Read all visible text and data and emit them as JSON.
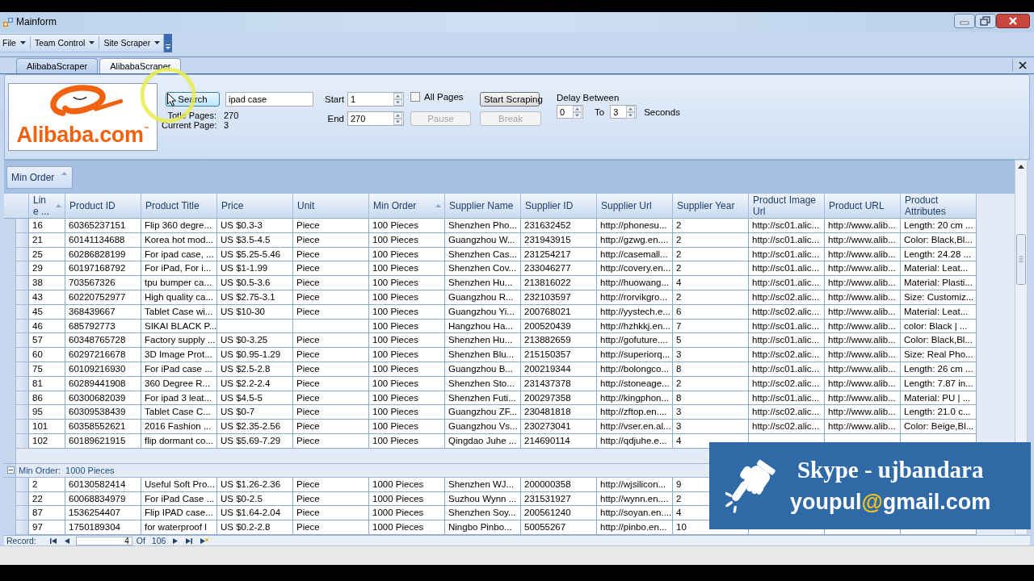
{
  "window": {
    "title": "Mainform"
  },
  "menu": [
    {
      "label": "File"
    },
    {
      "label": "Team Control"
    },
    {
      "label": "Site Scraper"
    }
  ],
  "tabs": [
    {
      "label": "AlibabaScraper",
      "selected": false
    },
    {
      "label": "AlibabaScraper",
      "selected": true
    }
  ],
  "search_panel": {
    "logo_text": "Alibaba.com$^{™}$",
    "search_button": {
      "label": "Search",
      "hovered": true,
      "disabled": false
    },
    "query": {
      "value": "ipad case"
    },
    "stats": [
      {
        "label": "Totle Pages:",
        "value": "270"
      },
      {
        "label": "Current Page:",
        "value": "3"
      }
    ],
    "start": {
      "label": "Start",
      "value": "1"
    },
    "end": {
      "label": "End",
      "value": "270"
    },
    "all_pages": {
      "label": "All Pages",
      "checked": false
    },
    "buttons": [
      {
        "label": "Start Scraping",
        "hovered": false,
        "disabled": false
      },
      {
        "label": "Pause",
        "hovered": false,
        "disabled": true
      },
      {
        "label": "Break",
        "hovered": false,
        "disabled": true
      }
    ],
    "delay": {
      "label": "Delay Between",
      "from": "0",
      "to_label": "To",
      "to": "3",
      "unit": "Seconds"
    }
  },
  "group_panel": {
    "chips": [
      {
        "label": "Min Order",
        "sorted": true
      }
    ]
  },
  "table": {
    "columns": [
      {
        "label": "Lin e ...",
        "sorted": true
      },
      {
        "label": "Product ID",
        "sorted": false
      },
      {
        "label": "Product Title",
        "sorted": false
      },
      {
        "label": "Price",
        "sorted": false
      },
      {
        "label": "Unit",
        "sorted": false
      },
      {
        "label": "Min Order",
        "sorted": true
      },
      {
        "label": "Supplier Name",
        "sorted": false
      },
      {
        "label": "Supplier ID",
        "sorted": false
      },
      {
        "label": "Supplier Url",
        "sorted": false
      },
      {
        "label": "Supplier Year",
        "sorted": false
      },
      {
        "label": "Product Image Url",
        "sorted": false
      },
      {
        "label": "Product URL",
        "sorted": false
      },
      {
        "label": "Product Attributes",
        "sorted": false
      }
    ],
    "groups": [
      {
        "rows": [
          [
            "16",
            "60365237151",
            "Flip 360 degre...",
            "US $0.3-3",
            "Piece",
            "100 Pieces",
            "Shenzhen Pho...",
            "231632452",
            "http://phonesu...",
            "2",
            "http://sc01.alic...",
            "http://www.alib...",
            "Length: 20 cm ..."
          ],
          [
            "21",
            "60141134688",
            "Korea hot mod...",
            "US $3.5-4.5",
            "Piece",
            "100 Pieces",
            "Guangzhou W...",
            "231943915",
            "http://gzwg.en....",
            "2",
            "http://sc01.alic...",
            "http://www.alib...",
            "Color: Black,Bl..."
          ],
          [
            "25",
            "60286828199",
            "For ipad case, ...",
            "US $5.25-5.46",
            "Piece",
            "100 Pieces",
            "Shenzhen Cas...",
            "231254217",
            "http://casemall...",
            "2",
            "http://sc01.alic...",
            "http://www.alib...",
            "Length: 24.28 ..."
          ],
          [
            "29",
            "60197168792",
            "For iPad, For i...",
            "US $1-1.99",
            "Piece",
            "100 Pieces",
            "Shenzhen Cov...",
            "233046277",
            "http://covery.en...",
            "2",
            "http://sc01.alic...",
            "http://www.alib...",
            "Material: Leat..."
          ],
          [
            "38",
            "703567326",
            "tpu bumper ca...",
            "US $0.5-3.6",
            "Piece",
            "100 Pieces",
            "Shenzhen Hu...",
            "213816022",
            "http://huowang...",
            "4",
            "http://sc01.alic...",
            "http://www.alib...",
            "Material: Plasti..."
          ],
          [
            "43",
            "60220752977",
            "High quality ca...",
            "US $2.75-3.1",
            "Piece",
            "100 Pieces",
            "Guangzhou R...",
            "232103597",
            "http://rorvikgro...",
            "2",
            "http://sc02.alic...",
            "http://www.alib...",
            "Size: Customiz..."
          ],
          [
            "45",
            "368439667",
            "Tablet Case wi...",
            "US $10-30",
            "Piece",
            "100 Pieces",
            "Guangzhou Yi...",
            "200768021",
            "http://yystech.e...",
            "6",
            "http://sc02.alic...",
            "http://www.alib...",
            "Material: Leat..."
          ],
          [
            "46",
            "685792773",
            "SIKAI BLACK P...",
            null,
            null,
            "100 Pieces",
            "Hangzhou Ha...",
            "200520439",
            "http://hzhkkj.en...",
            "7",
            "http://sc01.alic...",
            "http://www.alib...",
            "color: Black | ..."
          ],
          [
            "57",
            "60348765728",
            "Factory supply ...",
            "US $0-3.25",
            "Piece",
            "100 Pieces",
            "Shenzhen Hu...",
            "213882659",
            "http://gofuture....",
            "5",
            "http://sc01.alic...",
            "http://www.alib...",
            "Color: Black,Bl..."
          ],
          [
            "60",
            "60297216678",
            "3D Image Prot...",
            "US $0.95-1.29",
            "Piece",
            "100 Pieces",
            "Shenzhen Blu...",
            "215150357",
            "http://superiorq...",
            "3",
            "http://sc02.alic...",
            "http://www.alib...",
            "Size: Real Pho..."
          ],
          [
            "75",
            "60109216930",
            "For iPad case ...",
            "US $2.5-2.8",
            "Piece",
            "100 Pieces",
            "Guangzhou B...",
            "200219344",
            "http://bolongco...",
            "8",
            "http://sc01.alic...",
            "http://www.alib...",
            "Length: 26 cm ..."
          ],
          [
            "81",
            "60289441908",
            "360 Degree R...",
            "US $2.2-2.4",
            "Piece",
            "100 Pieces",
            "Shenzhen Sto...",
            "231437378",
            "http://stoneage...",
            "2",
            "http://sc02.alic...",
            "http://www.alib...",
            "Length: 7.87 in..."
          ],
          [
            "86",
            "60300682039",
            "For ipad 3 leat...",
            "US $4.5-5",
            "Piece",
            "100 Pieces",
            "Shenzhen Futi...",
            "200297358",
            "http://kingphon...",
            "8",
            "http://sc01.alic...",
            "http://www.alib...",
            "Material: PU | ..."
          ],
          [
            "95",
            "60309538439",
            "Tablet Case C...",
            "US $0-7",
            "Piece",
            "100 Pieces",
            "Guangzhou ZF...",
            "230481818",
            "http://zftop.en....",
            "3",
            "http://sc02.alic...",
            "http://www.alib...",
            "Length: 21.0 c..."
          ],
          [
            "101",
            "60358552621",
            "2016 Fashion ...",
            "US $2.35-2.56",
            "Piece",
            "100 Pieces",
            "Guangzhou Vs...",
            "230273041",
            "http://vser.en.al...",
            "3",
            "http://sc02.alic...",
            "http://www.alib...",
            "Color: Beige,Bl..."
          ],
          [
            "102",
            "60189621915",
            "flip dormant co...",
            "US $5.69-7.29",
            "Piece",
            "100 Pieces",
            "Qingdao Juhe ...",
            "214690114",
            "http://qdjuhe.e...",
            "4"
          ]
        ]
      },
      {
        "label": "Min Order:  1000 Pieces",
        "expanded": true,
        "rows": [
          [
            "2",
            "60130582414",
            "Useful Soft Pro...",
            "US $1.26-2.36",
            "Piece",
            "1000 Pieces",
            "Shenzhen WJ...",
            "200000358",
            "http://wjsilicon...",
            "9"
          ],
          [
            "22",
            "60068834979",
            "For iPad Case ...",
            "US $0-2.5",
            "Piece",
            "1000 Pieces",
            "Suzhou Wynn ...",
            "231531927",
            "http://wynn.en....",
            "2"
          ],
          [
            "87",
            "1536254407",
            "Flip IPAD case...",
            "US $1.64-2.04",
            "Piece",
            "1000 Pieces",
            "Shenzhen Soy...",
            "200561240",
            "http://soyan.en....",
            "4"
          ],
          [
            "97",
            "1750189304",
            "for waterproof l",
            "US $0.2-2.8",
            "Piece",
            "1000 Pieces",
            "Ningbo Pinbo...",
            "50055267",
            "http://pinbo.en...",
            "10"
          ]
        ]
      }
    ]
  },
  "navigator": {
    "label": "Record:",
    "current": "4",
    "of_label": "Of",
    "total": "106"
  },
  "banner": {
    "title": "Skype - ujbandara",
    "email_parts": [
      {
        "text": "youpul",
        "color": "#ffffff"
      },
      {
        "text": "@",
        "color": "#f2c21b"
      },
      {
        "text": "gmail.com",
        "color": "#ffffff"
      }
    ]
  }
}
